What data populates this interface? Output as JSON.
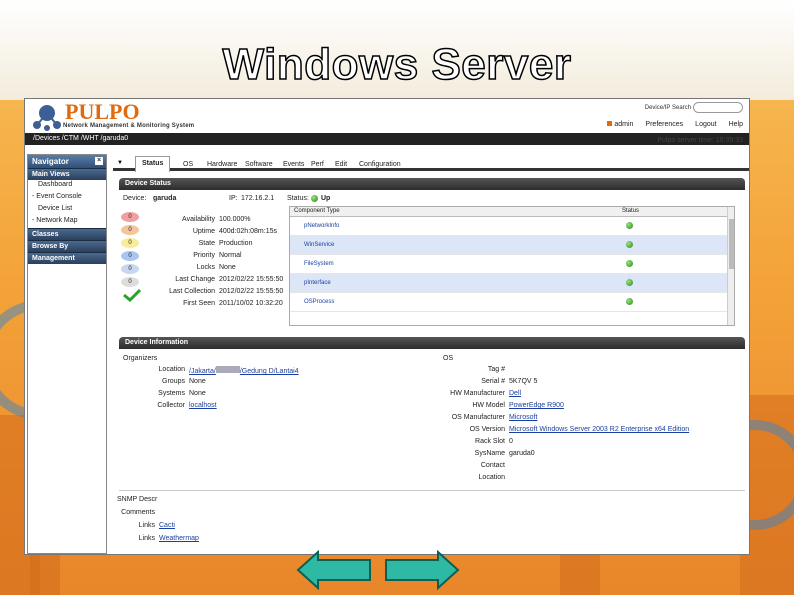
{
  "slide": {
    "title": "Windows Server"
  },
  "app": {
    "logo_text": "PULPO",
    "logo_subtitle": "Network Management & Monitoring System",
    "search_label": "Device/IP Search",
    "search_placeholder": "",
    "user_menu": [
      "admin",
      "Preferences",
      "Logout",
      "Help"
    ],
    "path": "/Devices /CTM /WHT /garuda0",
    "server_time": "Pulpo server time: 10:39:33"
  },
  "navigator": {
    "title": "Navigator",
    "sections": [
      {
        "label": "Main Views",
        "items": [
          "Dashboard",
          "- Event Console",
          "Device List",
          "- Network Map"
        ]
      },
      {
        "label": "Classes",
        "items": []
      },
      {
        "label": "Browse By",
        "items": []
      },
      {
        "label": "Management",
        "items": []
      }
    ]
  },
  "tabs": [
    "Status",
    "OS",
    "Hardware",
    "Software",
    "Events",
    "Perf",
    "Edit",
    "Configuration"
  ],
  "device_status": {
    "panel_title": "Device Status",
    "device_label": "Device:",
    "device_value": "garuda",
    "ip_label": "IP:",
    "ip_value": "172.16.2.1",
    "status_label": "Status:",
    "status_value": "Up",
    "severity_counts": [
      "0",
      "0",
      "0",
      "0",
      "0",
      "0"
    ],
    "fields": [
      {
        "k": "Availability",
        "v": "100.000%"
      },
      {
        "k": "Uptime",
        "v": "400d:02h:08m:15s"
      },
      {
        "k": "State",
        "v": "Production"
      },
      {
        "k": "Priority",
        "v": "Normal"
      },
      {
        "k": "Locks",
        "v": "None"
      },
      {
        "k": "Last Change",
        "v": "2012/02/22 15:55:50"
      },
      {
        "k": "Last Collection",
        "v": "2012/02/22 15:55:50"
      },
      {
        "k": "First Seen",
        "v": "2011/10/02 10:32:20"
      }
    ],
    "components_header": {
      "type": "Component Type",
      "status": "Status"
    },
    "components": [
      "pNetworkInfo",
      "WinService",
      "FileSystem",
      "pInterface",
      "OSProcess"
    ]
  },
  "device_info": {
    "panel_title": "Device Information",
    "organizers_title": "Organizers",
    "organizers": [
      {
        "k": "Location",
        "v": "/Jakarta/",
        "link": true
      },
      {
        "k": "Groups",
        "v": "None",
        "link": false
      },
      {
        "k": "Systems",
        "v": "None",
        "link": false
      },
      {
        "k": "Collector",
        "v": "localhost",
        "link": true
      }
    ],
    "location_suffix": "/Gedung D/Lantai4",
    "os_title": "OS",
    "os_fields": [
      {
        "k": "Tag #",
        "v": "",
        "link": false
      },
      {
        "k": "Serial #",
        "v": "5K7QV 5",
        "link": false
      },
      {
        "k": "HW Manufacturer",
        "v": "Dell",
        "link": true
      },
      {
        "k": "HW Model",
        "v": "PowerEdge R900",
        "link": true
      },
      {
        "k": "OS Manufacturer",
        "v": "Microsoft",
        "link": true
      },
      {
        "k": "OS Version",
        "v": "Microsoft Windows Server 2003 R2 Enterprise x64 Edition",
        "link": true
      },
      {
        "k": "Rack Slot",
        "v": "0",
        "link": false
      },
      {
        "k": "SysName",
        "v": "garuda0",
        "link": false
      },
      {
        "k": "Contact",
        "v": "",
        "link": false
      },
      {
        "k": "Location",
        "v": "",
        "link": false
      }
    ],
    "snmp_title": "SNMP Descr",
    "snmp_fields": [
      {
        "k": "Comments",
        "v": ""
      },
      {
        "k": "Links",
        "v": "Cacti"
      },
      {
        "k": "Links",
        "v": "Weathermap"
      }
    ]
  },
  "colors": {
    "accent": "#e06a10",
    "panel_header": "#333333",
    "nav_header": "#2e4f78",
    "link": "#1a3fa0",
    "up_green": "#1f8a1f"
  },
  "icons": [
    "shield-checkmark-icon",
    "search-icon",
    "close-icon",
    "status-up-icon",
    "prev-arrow-icon",
    "next-arrow-icon"
  ]
}
